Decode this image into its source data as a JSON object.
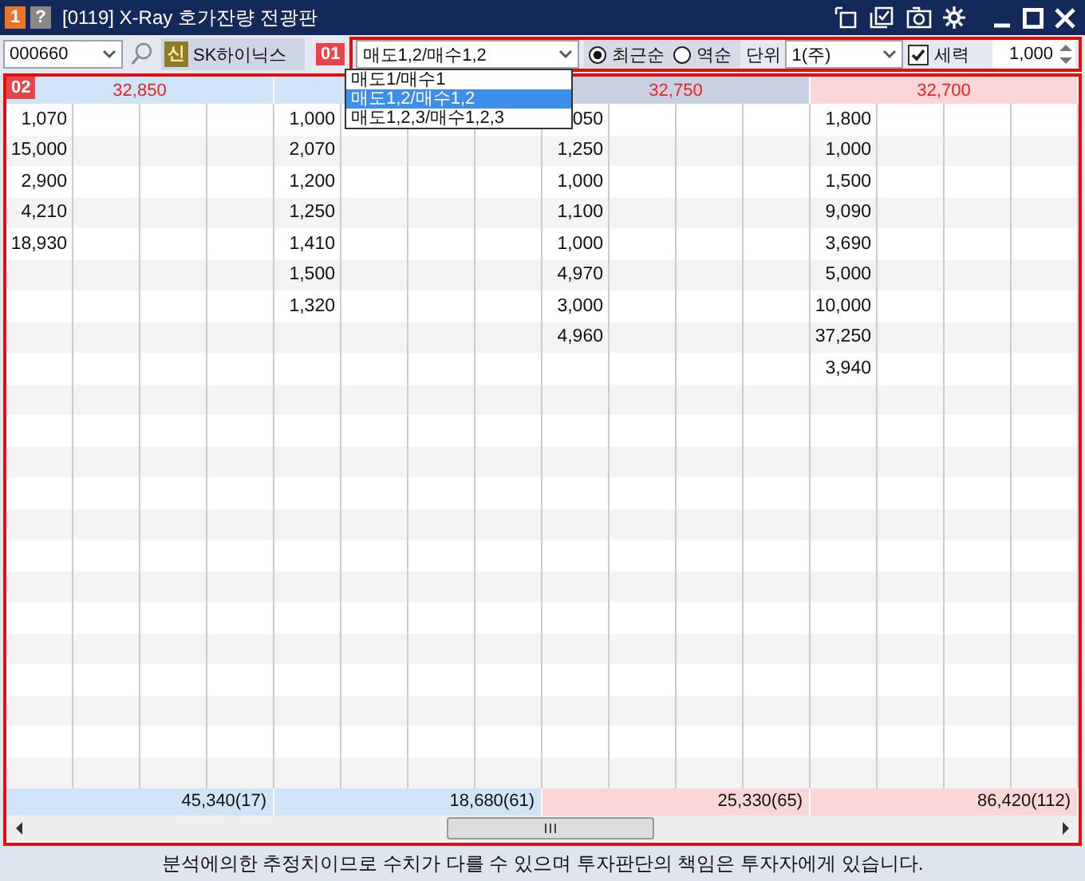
{
  "title_bar": {
    "number_badge": "1",
    "help_badge": "?",
    "title": "[0119] X-Ray 호가잔량 전광판"
  },
  "toolbar": {
    "code": "000660",
    "stock_badge": "신",
    "stock_name": "SK하이닉스",
    "marker": "01",
    "mode": "매도1,2/매수1,2",
    "mode_options": [
      {
        "label": "매도1/매수1",
        "selected": false
      },
      {
        "label": "매도1,2/매수1,2",
        "selected": true
      },
      {
        "label": "매도1,2,3/매수1,2,3",
        "selected": false
      }
    ],
    "order": [
      {
        "label": "최근순",
        "selected": true
      },
      {
        "label": "역순",
        "selected": false
      }
    ],
    "unit_label": "단위",
    "unit": "1(주)",
    "force": {
      "label": "세력",
      "checked": true
    },
    "amount": "1,000"
  },
  "grid": {
    "marker": "02",
    "groups": [
      {
        "price": "32,850",
        "color": "#cfe4f7",
        "values": [
          "1,070",
          "15,000",
          "2,900",
          "4,210",
          "18,930"
        ],
        "total": {
          "text": "45,340(17)",
          "color": "#cfe4f7"
        }
      },
      {
        "color": "#cfe4f7",
        "values": [
          "1,000",
          "2,070",
          "1,200",
          "1,250",
          "1,410",
          "1,500",
          "1,320"
        ],
        "total": {
          "text": "18,680(61)",
          "color": "#cfe4f7"
        }
      },
      {
        "price": "32,750",
        "color": "#c9d0e2",
        "values": [
          "050",
          "1,250",
          "1,000",
          "1,100",
          "1,000",
          "4,970",
          "3,000",
          "4,960"
        ],
        "total": {
          "text": "25,330(65)",
          "color": "#fad6d6"
        }
      },
      {
        "price": "32,700",
        "color": "#fad6d6",
        "values": [
          "1,800",
          "1,000",
          "1,500",
          "9,090",
          "3,690",
          "5,000",
          "10,000",
          "37,250",
          "3,940"
        ],
        "total": {
          "text": "86,420(112)",
          "color": "#fad6d6"
        }
      }
    ]
  },
  "footer": "분석에의한 추정치이므로 수치가 다를 수 있으며 투자판단의 책임은 투자자에게 있습니다."
}
